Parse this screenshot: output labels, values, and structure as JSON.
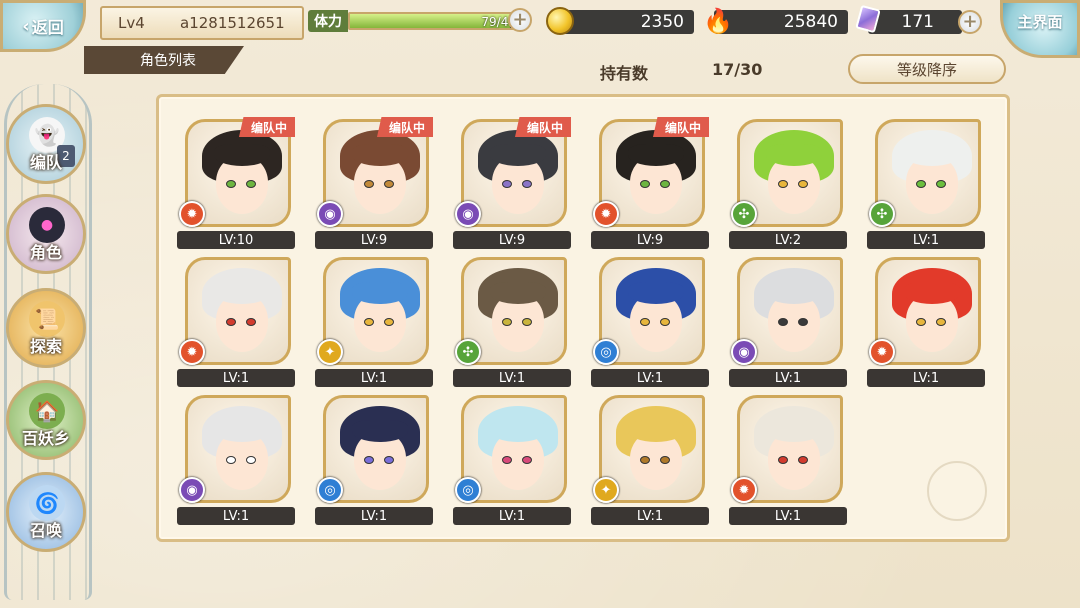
{
  "top_bar": {
    "back_label": "返回",
    "level": "Lv4",
    "player_id": "a1281512651",
    "stamina_label": "体力",
    "stamina_value": "79/43",
    "stamina_fraction": 0.93,
    "coins": "2350",
    "soul_fire": "25840",
    "gems": "171",
    "main_label": "主界面"
  },
  "header": {
    "tab_title": "角色列表",
    "owned_label": "持有数",
    "owned_value": "17/30",
    "sort_label": "等级降序"
  },
  "nav": {
    "items": [
      {
        "label": "编队",
        "badge": "2"
      },
      {
        "label": "角色"
      },
      {
        "label": "探索"
      },
      {
        "label": "百妖乡"
      },
      {
        "label": "召唤"
      }
    ]
  },
  "colors": {
    "accent_gold": "#c9ad74",
    "team_tag": "#e05b4b",
    "element_fire": "#e2522c",
    "element_dark": "#7a4bb5",
    "element_wind": "#57a43a",
    "element_light": "#e0a91f",
    "element_water": "#2f7fd4"
  },
  "characters": [
    {
      "level": "LV:10",
      "team_tag": "编队中",
      "element": "fire",
      "hair": "#2d2622",
      "eye": "#6db540"
    },
    {
      "level": "LV:9",
      "team_tag": "编队中",
      "element": "dark",
      "hair": "#7a4a33",
      "eye": "#c28a3a"
    },
    {
      "level": "LV:9",
      "team_tag": "编队中",
      "element": "dark",
      "hair": "#3a3b40",
      "eye": "#8b74c7"
    },
    {
      "level": "LV:9",
      "team_tag": "编队中",
      "element": "fire",
      "hair": "#27231f",
      "eye": "#6db540"
    },
    {
      "level": "LV:2",
      "team_tag": "",
      "element": "wind",
      "hair": "#8fd13b",
      "eye": "#e7b63d"
    },
    {
      "level": "LV:1",
      "team_tag": "",
      "element": "wind",
      "hair": "#eef0ee",
      "eye": "#6bbf3e"
    },
    {
      "level": "LV:1",
      "team_tag": "",
      "element": "fire",
      "hair": "#e9e8e6",
      "eye": "#d23b2e"
    },
    {
      "level": "LV:1",
      "team_tag": "",
      "element": "light",
      "hair": "#4a8fd8",
      "eye": "#e7b63d"
    },
    {
      "level": "LV:1",
      "team_tag": "",
      "element": "wind",
      "hair": "#6b5a45",
      "eye": "#c9b53d"
    },
    {
      "level": "LV:1",
      "team_tag": "",
      "element": "water",
      "hair": "#2c4fa8",
      "eye": "#e7b63d"
    },
    {
      "level": "LV:1",
      "team_tag": "",
      "element": "dark",
      "hair": "#dcdddf",
      "eye": "#3a3a3a"
    },
    {
      "level": "LV:1",
      "team_tag": "",
      "element": "fire",
      "hair": "#e23a2a",
      "eye": "#e7b63d"
    },
    {
      "level": "LV:1",
      "team_tag": "",
      "element": "dark",
      "hair": "#e6e6e6",
      "eye": "#ffffff"
    },
    {
      "level": "LV:1",
      "team_tag": "",
      "element": "water",
      "hair": "#2a2f52",
      "eye": "#7a6ed8"
    },
    {
      "level": "LV:1",
      "team_tag": "",
      "element": "water",
      "hair": "#bfe6ef",
      "eye": "#d84a7a"
    },
    {
      "level": "LV:1",
      "team_tag": "",
      "element": "light",
      "hair": "#e9c75a",
      "eye": "#b07a2a"
    },
    {
      "level": "LV:1",
      "team_tag": "",
      "element": "fire",
      "hair": "#ece7dc",
      "eye": "#d23b2e"
    }
  ]
}
